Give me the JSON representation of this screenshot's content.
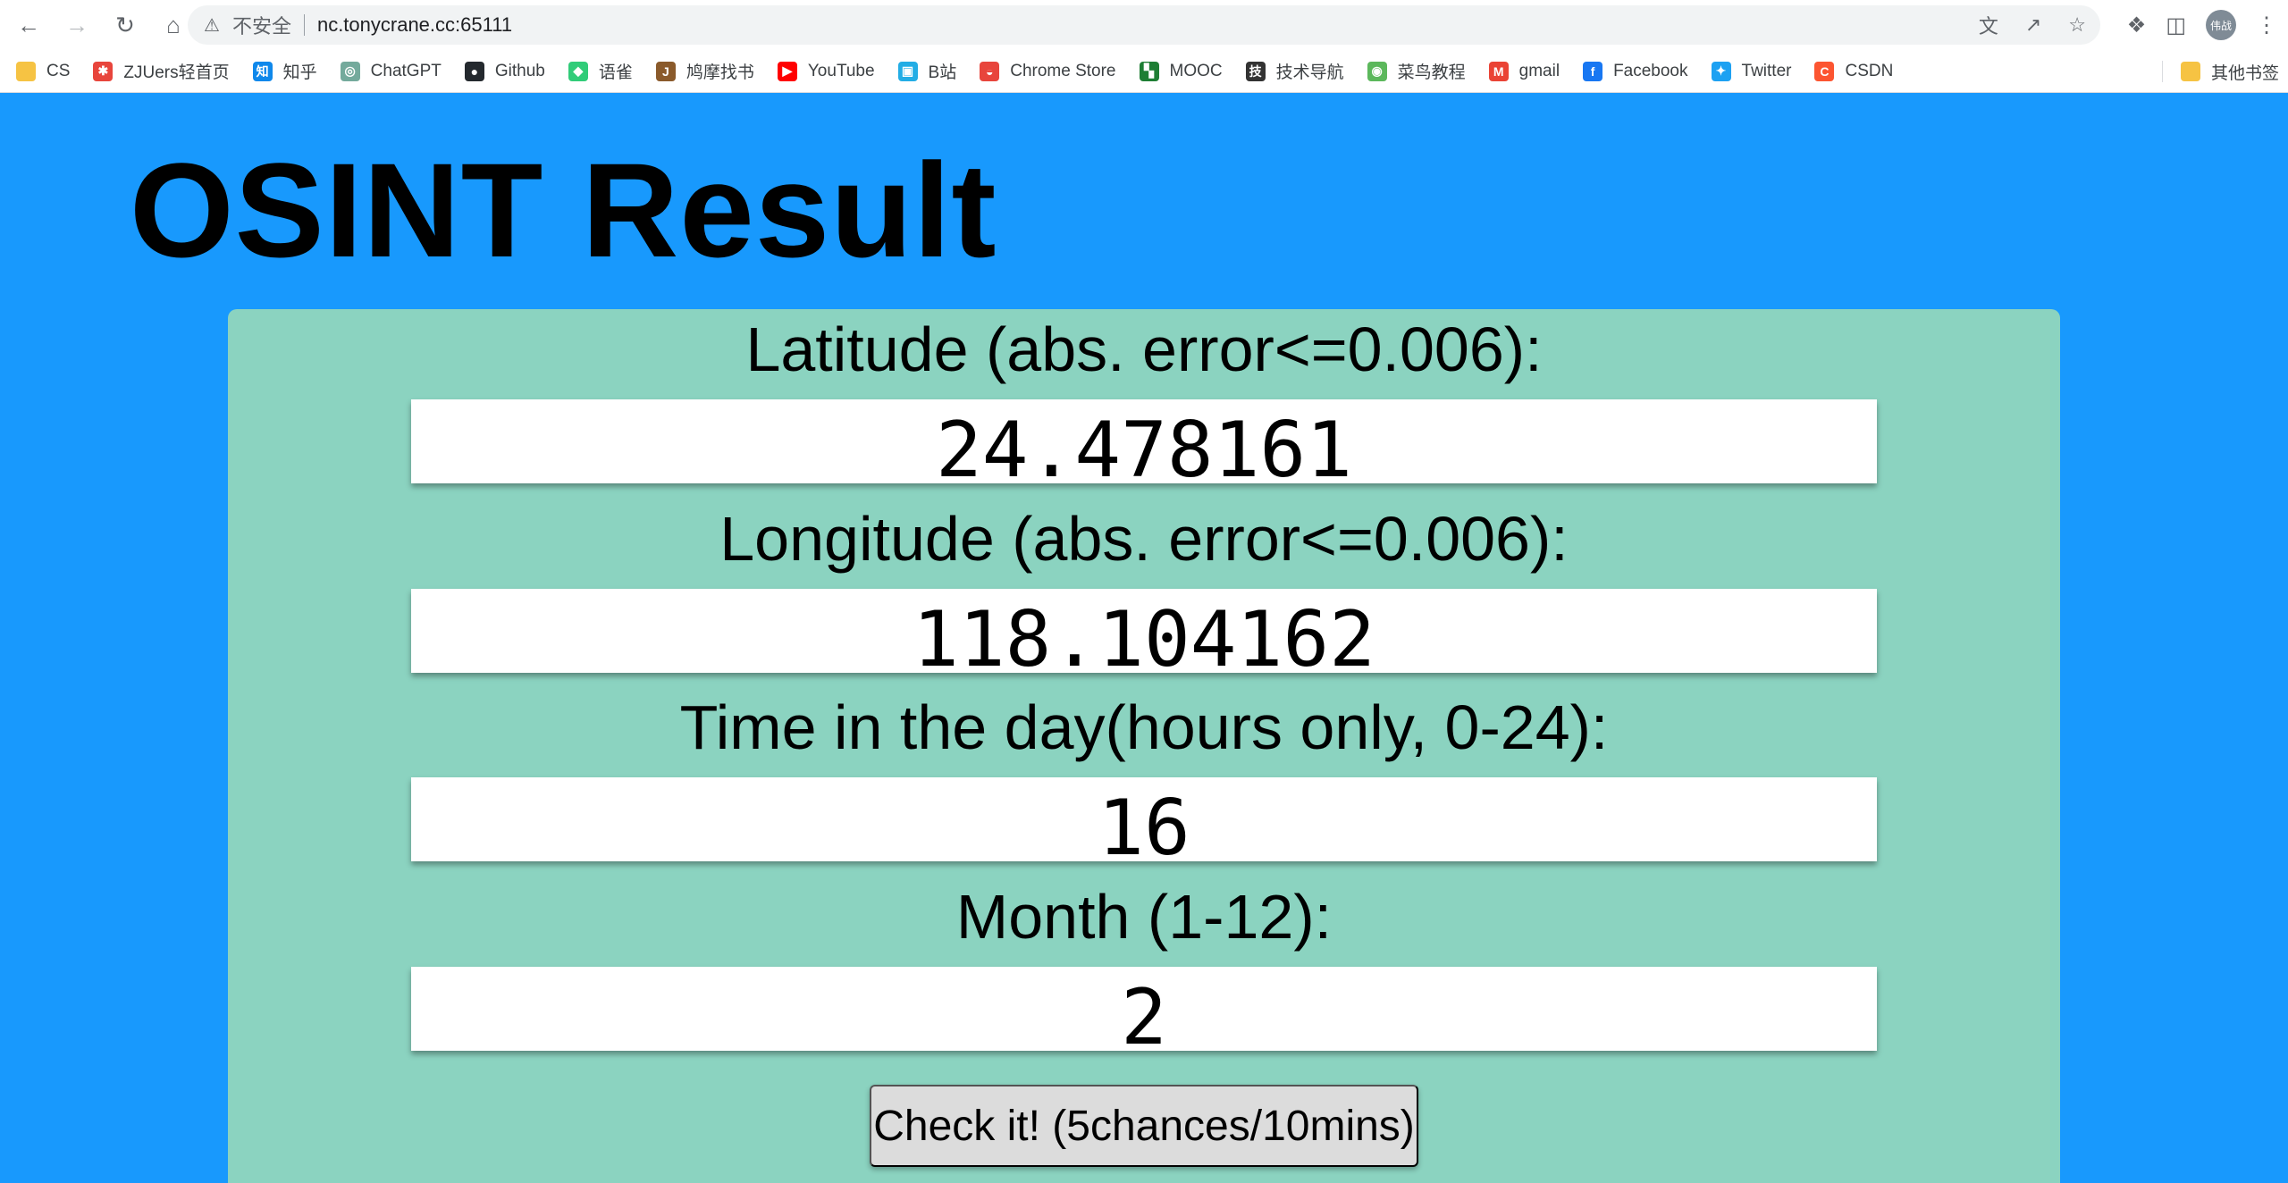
{
  "browser": {
    "address": {
      "security_label": "不安全",
      "url": "nc.tonycrane.cc:65111"
    },
    "profile_initials": "伟战",
    "bookmarks": [
      {
        "label": "CS",
        "icon": "folder-icon",
        "color": "#f6c343"
      },
      {
        "label": "ZJUers轻首页",
        "icon": "zju-icon",
        "color": "#e8453c"
      },
      {
        "label": "知乎",
        "icon": "zhihu-icon",
        "color": "#0f88eb"
      },
      {
        "label": "ChatGPT",
        "icon": "chatgpt-icon",
        "color": "#74aa9c"
      },
      {
        "label": "Github",
        "icon": "github-icon",
        "color": "#24292e"
      },
      {
        "label": "语雀",
        "icon": "yuque-icon",
        "color": "#31cc79"
      },
      {
        "label": "鸠摩找书",
        "icon": "jiumo-icon",
        "color": "#8a5a2b"
      },
      {
        "label": "YouTube",
        "icon": "youtube-icon",
        "color": "#ff0000"
      },
      {
        "label": "B站",
        "icon": "bilibili-icon",
        "color": "#23ade5"
      },
      {
        "label": "Chrome Store",
        "icon": "chrome-store-icon",
        "color": "#e8453c"
      },
      {
        "label": "MOOC",
        "icon": "mooc-icon",
        "color": "#1e7e34"
      },
      {
        "label": "技术导航",
        "icon": "tech-nav-icon",
        "color": "#333333"
      },
      {
        "label": "菜鸟教程",
        "icon": "runoob-icon",
        "color": "#5cb85c"
      },
      {
        "label": "gmail",
        "icon": "gmail-icon",
        "color": "#ea4335"
      },
      {
        "label": "Facebook",
        "icon": "facebook-icon",
        "color": "#1877f2"
      },
      {
        "label": "Twitter",
        "icon": "twitter-icon",
        "color": "#1da1f2"
      },
      {
        "label": "CSDN",
        "icon": "csdn-icon",
        "color": "#fc5531"
      }
    ],
    "other_bookmarks": "其他书签"
  },
  "page": {
    "title": "OSINT Result",
    "fields": [
      {
        "label": "Latitude (abs. error<=0.006):",
        "value": "24.478161"
      },
      {
        "label": "Longitude (abs. error<=0.006):",
        "value": "118.104162"
      },
      {
        "label": "Time in the day(hours only, 0-24):",
        "value": "16"
      },
      {
        "label": "Month (1-12):",
        "value": "2"
      }
    ],
    "submit_label": "Check it! (5chances/10mins)"
  },
  "colors": {
    "page_background": "#1899fd",
    "card_background": "#8bd3c0",
    "button_background": "#dcdcdc"
  }
}
